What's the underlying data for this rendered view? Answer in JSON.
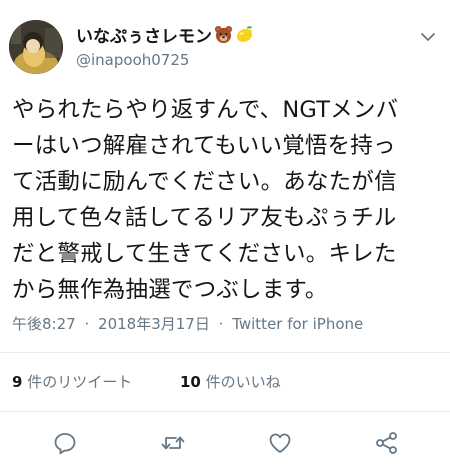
{
  "tweet": {
    "display_name": "いなぷぅさレモン",
    "emoji_icons": [
      "bear-face-icon",
      "lemon-icon"
    ],
    "handle": "@inapooh0725",
    "body_lines": [
      "やられたらやり返すんで、NGTメンバ",
      "ーはいつ解雇されてもいい覚悟を持っ",
      "て活動に励んでください。あなたが信",
      "用して色々話してるリア友もぷぅチル",
      "だと警戒して生きてください。キレた",
      "から無作為抽選でつぶします。"
    ],
    "time": "午後8:27",
    "separator": "·",
    "date": "2018年3月17日",
    "client": "Twitter for iPhone"
  },
  "stats": {
    "retweets_count": "9",
    "retweets_label": " 件のリツイート",
    "likes_count": "10",
    "likes_label": " 件のいいね"
  },
  "actions": [
    "reply-icon",
    "retweet-icon",
    "like-icon",
    "share-icon"
  ],
  "colors": {
    "text": "#14171a",
    "muted": "#657786",
    "divider": "#e6ecf0",
    "icon": "#657786"
  }
}
